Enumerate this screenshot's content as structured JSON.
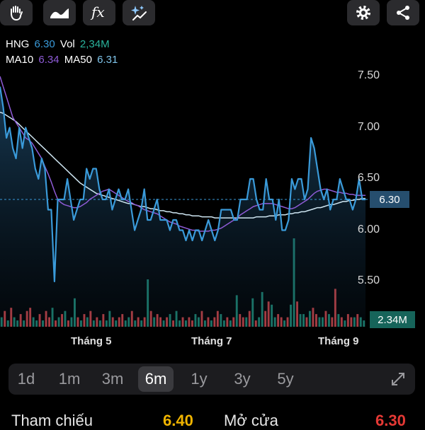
{
  "toolbar": {
    "left_icons": [
      "hand-icon",
      "area-chart-icon",
      "fx-icon",
      "sparkle-chart-icon"
    ],
    "right_icons": [
      "gear-icon",
      "share-icon"
    ],
    "fx_label": "fx"
  },
  "legend": {
    "ticker": "HNG",
    "price": "6.30",
    "vol_label": "Vol",
    "vol": "2,34M",
    "ma10_label": "MA10",
    "ma10": "6.34",
    "ma50_label": "MA50",
    "ma50": "6.31"
  },
  "colors": {
    "price": "#3a9ad9",
    "ma10": "#8e5bd6",
    "ma50": "#cfe6f2",
    "vol_up": "#1f8f7a",
    "vol_down": "#d9464a",
    "current_price_tag": "#264e6e",
    "vol_tag": "#16645a",
    "ref_value": "#f0b400",
    "open_value": "#e53935"
  },
  "y_axis": [
    "7.50",
    "7.00",
    "6.50",
    "6.00",
    "5.50"
  ],
  "x_axis": [
    "Tháng 5",
    "Tháng 7",
    "Tháng 9"
  ],
  "current_price_tag": "6.30",
  "volume_tag": "2.34M",
  "periods": [
    "1d",
    "1m",
    "3m",
    "6m",
    "1y",
    "3y",
    "5y"
  ],
  "active_period": "6m",
  "stats": {
    "ref_label": "Tham chiếu",
    "ref_value": "6.40",
    "open_label": "Mở cửa",
    "open_value": "6.30"
  },
  "chart_data": {
    "type": "line",
    "title": "",
    "ylim": [
      5.2,
      7.7
    ],
    "series": [
      {
        "name": "HNG",
        "values": [
          7.4,
          7.2,
          6.9,
          7.0,
          6.8,
          6.7,
          7.0,
          6.8,
          7.0,
          6.9,
          6.8,
          6.6,
          6.5,
          6.7,
          6.6,
          6.2,
          6.2,
          5.5,
          6.3,
          6.3,
          6.3,
          6.5,
          6.3,
          6.1,
          6.2,
          6.3,
          6.3,
          6.6,
          6.5,
          6.6,
          6.6,
          6.4,
          6.3,
          6.3,
          6.4,
          6.2,
          6.3,
          6.4,
          6.3,
          6.3,
          6.4,
          6.2,
          6.0,
          6.1,
          6.2,
          6.4,
          6.1,
          6.1,
          6.2,
          6.3,
          6.1,
          6.1,
          6.1,
          6.0,
          6.1,
          6.1,
          6.0,
          6.0,
          5.9,
          6.0,
          5.9,
          6.0,
          6.0,
          5.9,
          6.0,
          6.1,
          6.0,
          5.9,
          6.0,
          6.2,
          6.2,
          6.2,
          6.2,
          6.1,
          6.1,
          6.3,
          6.3,
          6.3,
          6.5,
          6.5,
          6.3,
          6.2,
          6.2,
          6.5,
          6.3,
          6.3,
          6.1,
          6.3,
          6.0,
          6.0,
          6.1,
          6.5,
          6.4,
          6.5,
          6.5,
          6.3,
          6.4,
          6.9,
          6.8,
          6.6,
          6.4,
          6.3,
          6.4,
          6.2,
          6.3,
          6.3,
          6.5,
          6.4,
          6.3,
          6.3,
          6.2,
          6.3,
          6.5,
          6.3,
          6.3
        ]
      },
      {
        "name": "MA10",
        "values": [
          7.5,
          7.4,
          7.3,
          7.2,
          7.1,
          7.05,
          7.0,
          6.95,
          6.9,
          6.88,
          6.85,
          6.8,
          6.75,
          6.7,
          6.62,
          6.55,
          6.47,
          6.38,
          6.3,
          6.27,
          6.25,
          6.24,
          6.23,
          6.22,
          6.22,
          6.23,
          6.25,
          6.27,
          6.3,
          6.32,
          6.34,
          6.36,
          6.38,
          6.39,
          6.4,
          6.38,
          6.36,
          6.34,
          6.32,
          6.3,
          6.28,
          6.27,
          6.25,
          6.24,
          6.22,
          6.2,
          6.19,
          6.18,
          6.17,
          6.16,
          6.14,
          6.12,
          6.1,
          6.08,
          6.07,
          6.06,
          6.04,
          6.03,
          6.02,
          6.01,
          6.0,
          6.0,
          5.99,
          5.99,
          5.99,
          5.99,
          6.0,
          6.0,
          6.01,
          6.02,
          6.04,
          6.06,
          6.08,
          6.1,
          6.12,
          6.15,
          6.17,
          6.19,
          6.21,
          6.23,
          6.24,
          6.25,
          6.26,
          6.26,
          6.26,
          6.26,
          6.25,
          6.24,
          6.23,
          6.22,
          6.21,
          6.21,
          6.22,
          6.24,
          6.26,
          6.28,
          6.3,
          6.33,
          6.36,
          6.38,
          6.39,
          6.4,
          6.4,
          6.39,
          6.38,
          6.37,
          6.37,
          6.36,
          6.36,
          6.35,
          6.35,
          6.34,
          6.34,
          6.34,
          6.34
        ]
      },
      {
        "name": "MA50",
        "values": [
          7.15,
          7.14,
          7.12,
          7.1,
          7.08,
          7.06,
          7.03,
          7.0,
          6.97,
          6.94,
          6.91,
          6.88,
          6.85,
          6.82,
          6.79,
          6.76,
          6.73,
          6.7,
          6.67,
          6.64,
          6.61,
          6.58,
          6.55,
          6.52,
          6.49,
          6.46,
          6.44,
          6.42,
          6.4,
          6.38,
          6.36,
          6.35,
          6.34,
          6.33,
          6.32,
          6.31,
          6.3,
          6.29,
          6.28,
          6.27,
          6.26,
          6.26,
          6.25,
          6.24,
          6.23,
          6.23,
          6.22,
          6.21,
          6.21,
          6.2,
          6.19,
          6.19,
          6.18,
          6.18,
          6.17,
          6.17,
          6.16,
          6.16,
          6.15,
          6.15,
          6.14,
          6.14,
          6.14,
          6.13,
          6.13,
          6.13,
          6.13,
          6.12,
          6.12,
          6.12,
          6.12,
          6.12,
          6.12,
          6.12,
          6.12,
          6.12,
          6.12,
          6.12,
          6.12,
          6.12,
          6.13,
          6.13,
          6.13,
          6.13,
          6.14,
          6.14,
          6.14,
          6.15,
          6.15,
          6.15,
          6.16,
          6.16,
          6.17,
          6.17,
          6.18,
          6.18,
          6.19,
          6.2,
          6.21,
          6.22,
          6.22,
          6.23,
          6.24,
          6.25,
          6.25,
          6.26,
          6.27,
          6.28,
          6.28,
          6.29,
          6.29,
          6.3,
          6.3,
          6.31,
          6.31
        ]
      }
    ],
    "volume": [
      3,
      5,
      2,
      6,
      3,
      2,
      4,
      2,
      5,
      6,
      3,
      2,
      4,
      2,
      5,
      3,
      6,
      2,
      3,
      4,
      5,
      2,
      3,
      9,
      3,
      2,
      4,
      3,
      5,
      2,
      3,
      2,
      4,
      2,
      5,
      3,
      2,
      3,
      4,
      2,
      3,
      5,
      2,
      3,
      2,
      3,
      15,
      5,
      3,
      4,
      3,
      2,
      3,
      4,
      2,
      5,
      2,
      3,
      2,
      3,
      2,
      4,
      3,
      5,
      2,
      3,
      2,
      3,
      5,
      4,
      2,
      3,
      2,
      3,
      10,
      4,
      3,
      3,
      5,
      9,
      2,
      3,
      11,
      5,
      8,
      7,
      3,
      4,
      3,
      2,
      3,
      7,
      28,
      8,
      4,
      4,
      3,
      5,
      6,
      4,
      3,
      3,
      5,
      4,
      3,
      12,
      4,
      3,
      2,
      4,
      3,
      3,
      4,
      3,
      2
    ],
    "volume_up": [
      1,
      0,
      1,
      0,
      1,
      1,
      0,
      1,
      0,
      0,
      1,
      1,
      0,
      1,
      0,
      0,
      1,
      0,
      1,
      0,
      1,
      0,
      1,
      1,
      0,
      1,
      0,
      1,
      0,
      1,
      0,
      1,
      0,
      1,
      1,
      0,
      1,
      0,
      0,
      1,
      1,
      0,
      1,
      0,
      1,
      0,
      1,
      0,
      1,
      0,
      0,
      1,
      0,
      1,
      0,
      1,
      1,
      0,
      1,
      0,
      0,
      1,
      1,
      0,
      1,
      0,
      1,
      0,
      0,
      1,
      1,
      0,
      1,
      0,
      1,
      0,
      0,
      1,
      0,
      1,
      0,
      1,
      1,
      0,
      0,
      1,
      1,
      0,
      0,
      1,
      0,
      1,
      1,
      0,
      1,
      1,
      0,
      1,
      0,
      0,
      1,
      1,
      0,
      1,
      0,
      0,
      1,
      0,
      1,
      0,
      0,
      1,
      0,
      1,
      1
    ]
  }
}
